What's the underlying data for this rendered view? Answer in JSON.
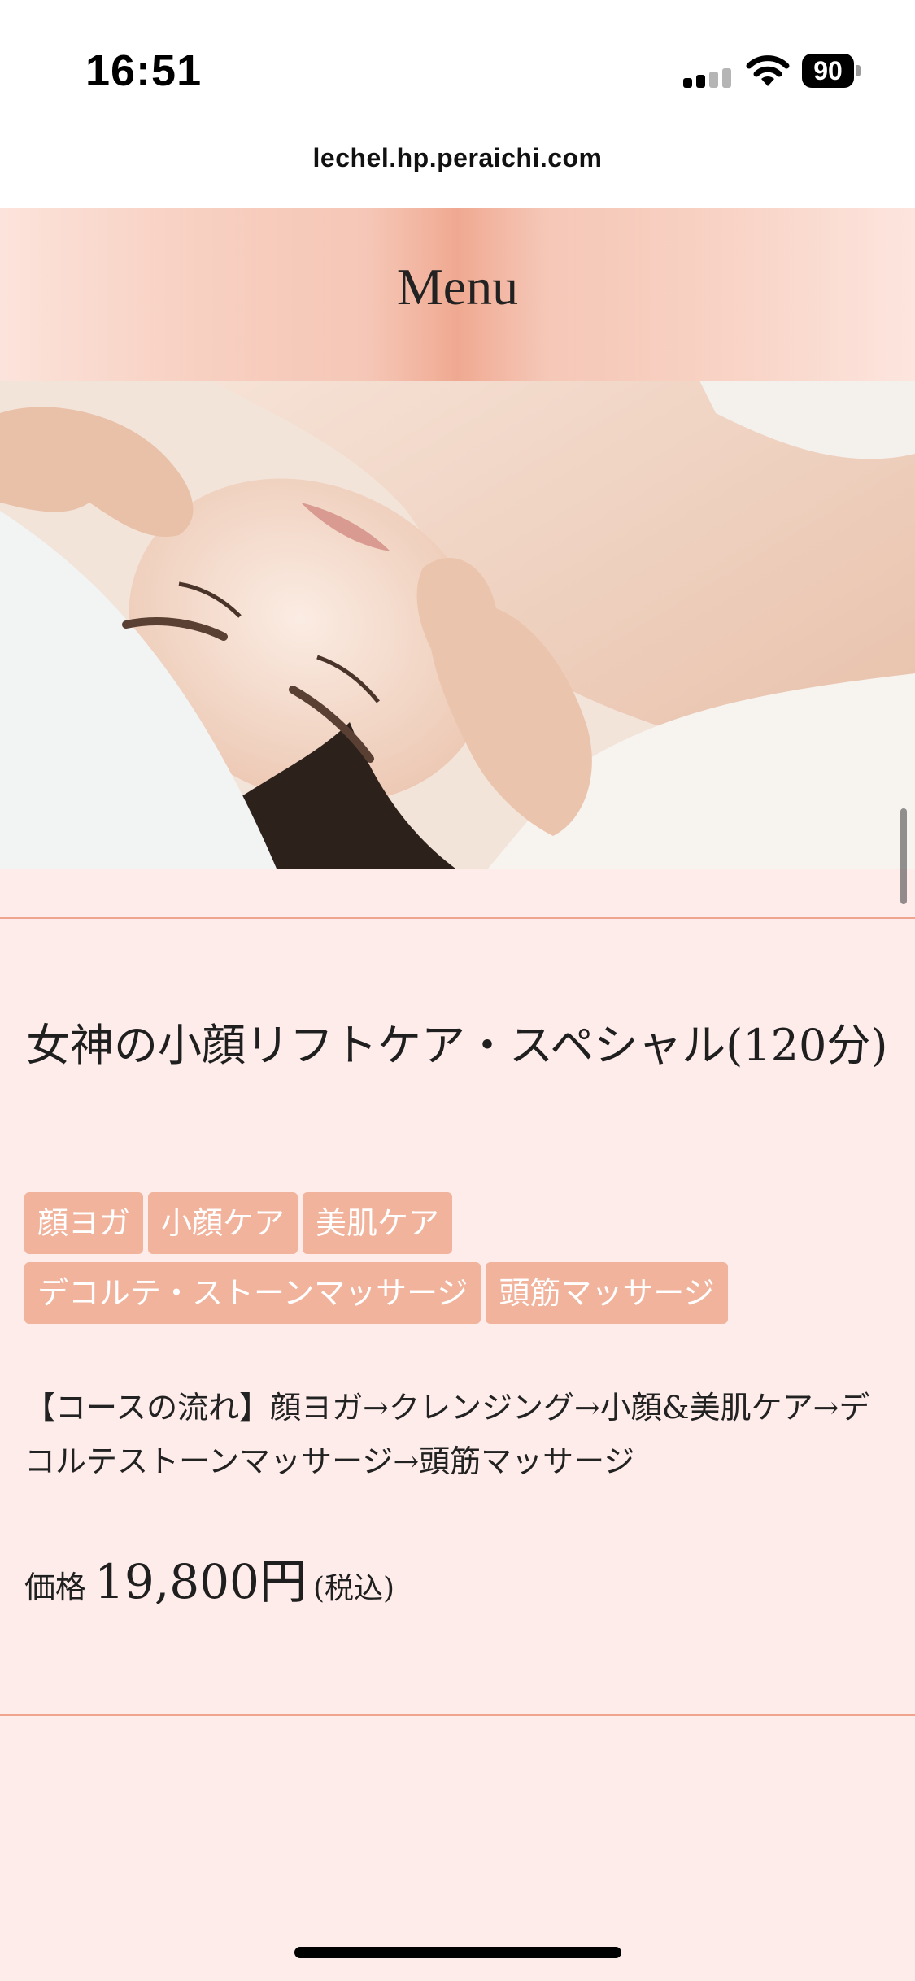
{
  "status_bar": {
    "time": "16:51",
    "battery": "90"
  },
  "browser": {
    "url": "lechel.hp.peraichi.com"
  },
  "section": {
    "title": "Menu"
  },
  "course": {
    "title": "女神の小顔リフトケア・スペシャル(120分)",
    "tags": [
      "顔ヨガ",
      "小顔ケア",
      "美肌ケア",
      "デコルテ・ストーンマッサージ",
      "頭筋マッサージ"
    ],
    "flow": "【コースの流れ】顔ヨガ→クレンジング→小顔&美肌ケア→デコルテストーンマッサージ→頭筋マッサージ",
    "price_label": "価格",
    "price_amount": "19,800円",
    "price_tax": "(税込)"
  },
  "colors": {
    "content_bg": "#fdecea",
    "tag_bg": "#f1b39c",
    "divider": "#f0a48f"
  }
}
